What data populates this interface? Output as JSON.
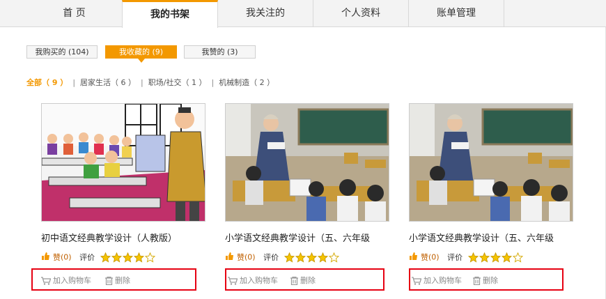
{
  "topnav": {
    "tabs": [
      {
        "label": "首  页",
        "active": false
      },
      {
        "label": "我的书架",
        "active": true
      },
      {
        "label": "我关注的",
        "active": false
      },
      {
        "label": "个人资料",
        "active": false
      },
      {
        "label": "账单管理",
        "active": false
      }
    ]
  },
  "subtabs": [
    {
      "label": "我购买的 (104)",
      "active": false
    },
    {
      "label": "我收藏的 (9)",
      "active": true
    },
    {
      "label": "我赞的 (3)",
      "active": false
    }
  ],
  "filters": [
    {
      "label": "全部（ 9 ）",
      "selected": true
    },
    {
      "label": "居家生活（ 6 ）",
      "selected": false
    },
    {
      "label": "职场/社交（ 1 ）",
      "selected": false
    },
    {
      "label": "机械制造（ 2 ）",
      "selected": false
    }
  ],
  "cards": [
    {
      "title": "初中语文经典教学设计（人教版）",
      "like_label": "赞",
      "like_count": "(0)",
      "rating_label": "评价",
      "rating": 4,
      "rating_max": 5,
      "add_cart_label": "加入购物车",
      "delete_label": "删除",
      "image": "cartoon-classroom"
    },
    {
      "title": "小学语文经典教学设计（五、六年级",
      "like_label": "赞",
      "like_count": "(0)",
      "rating_label": "评价",
      "rating": 4,
      "rating_max": 5,
      "add_cart_label": "加入购物车",
      "delete_label": "删除",
      "image": "photo-classroom"
    },
    {
      "title": "小学语文经典教学设计（五、六年级",
      "like_label": "赞",
      "like_count": "(0)",
      "rating_label": "评价",
      "rating": 4,
      "rating_max": 5,
      "add_cart_label": "加入购物车",
      "delete_label": "删除",
      "image": "photo-classroom"
    }
  ],
  "icons": {
    "like": "thumbs-up-icon",
    "star": "star-icon",
    "cart": "cart-icon",
    "delete": "trash-icon"
  },
  "colors": {
    "accent": "#f39800",
    "highlight_box": "#e60012",
    "star_fill": "#f5c400"
  }
}
